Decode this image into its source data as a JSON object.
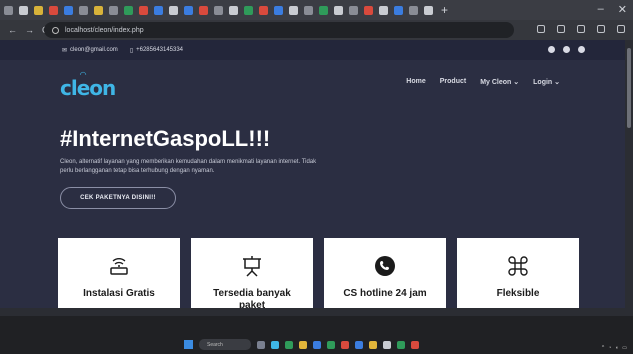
{
  "browser": {
    "url": "localhost/cleon/index.php",
    "new_tab": "+",
    "win_min": "–",
    "win_close": "✕"
  },
  "topbar": {
    "email": "cleon@gmail.com",
    "phone": "+6285643145334"
  },
  "logo": {
    "text": "cleon"
  },
  "menu": {
    "items": [
      "Home",
      "Product",
      "My Cleon ⌄",
      "Login ⌄"
    ]
  },
  "hero": {
    "title": "#InternetGaspoLL!!!",
    "description": "Cleon, alternatif layanan yang memberikan kemudahan dalam menikmati layanan internet. Tidak perlu berlangganan tetap bisa terhubung dengan nyaman.",
    "cta": "CEK PAKETNYA DISINI!!"
  },
  "cards": [
    {
      "icon": "router-icon",
      "label": "Instalasi Gratis"
    },
    {
      "icon": "presentation-icon",
      "label": "Tersedia banyak paket"
    },
    {
      "icon": "phone-icon",
      "label": "CS hotline 24 jam"
    },
    {
      "icon": "command-icon",
      "label": "Fleksible"
    }
  ],
  "taskbar": {
    "search_placeholder": "Search"
  },
  "colors": {
    "accent": "#3fb6e6",
    "site_bg": "#2b2e42",
    "topbar_bg": "#23263a"
  }
}
